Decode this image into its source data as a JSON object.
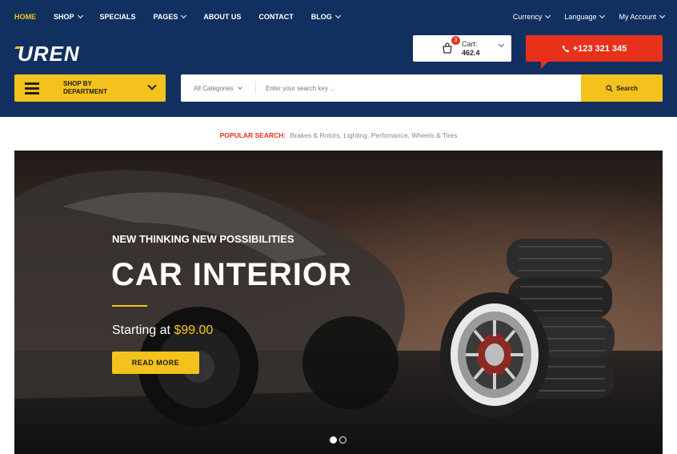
{
  "topnav": {
    "items": [
      {
        "label": "HOME",
        "active": true,
        "has_dropdown": false
      },
      {
        "label": "SHOP",
        "active": false,
        "has_dropdown": true
      },
      {
        "label": "SPECIALS",
        "active": false,
        "has_dropdown": false
      },
      {
        "label": "PAGES",
        "active": false,
        "has_dropdown": true
      },
      {
        "label": "ABOUT US",
        "active": false,
        "has_dropdown": false
      },
      {
        "label": "CONTACT",
        "active": false,
        "has_dropdown": false
      },
      {
        "label": "BLOG",
        "active": false,
        "has_dropdown": true
      }
    ],
    "right": {
      "currency": "Currency",
      "language": "Language",
      "account": "My Account"
    }
  },
  "brand": {
    "logo_text": "UREN"
  },
  "cart": {
    "count": "3",
    "label": "Cart:",
    "value": "462.4"
  },
  "phone": {
    "number": "+123 321 345"
  },
  "department": {
    "line1": "SHOP BY",
    "line2": "DEPARTMENT"
  },
  "search": {
    "category": "All Categories",
    "placeholder": "Enter your search key ...",
    "button_label": "Search"
  },
  "popular": {
    "label": "POPULAR SEARCH:",
    "terms": "Brakes & Rotors, Lighting, Perfomance, Wheels & Tires"
  },
  "hero": {
    "subtitle": "NEW THINKING NEW POSSIBILITIES",
    "title": "CAR INTERIOR",
    "price_prefix": "Starting at ",
    "price": "$99.00",
    "button": "READ MORE",
    "slides": 2,
    "active_slide": 1
  },
  "colors": {
    "header_bg": "#12305f",
    "accent_yellow": "#f4c21c",
    "accent_red": "#e8311a"
  }
}
